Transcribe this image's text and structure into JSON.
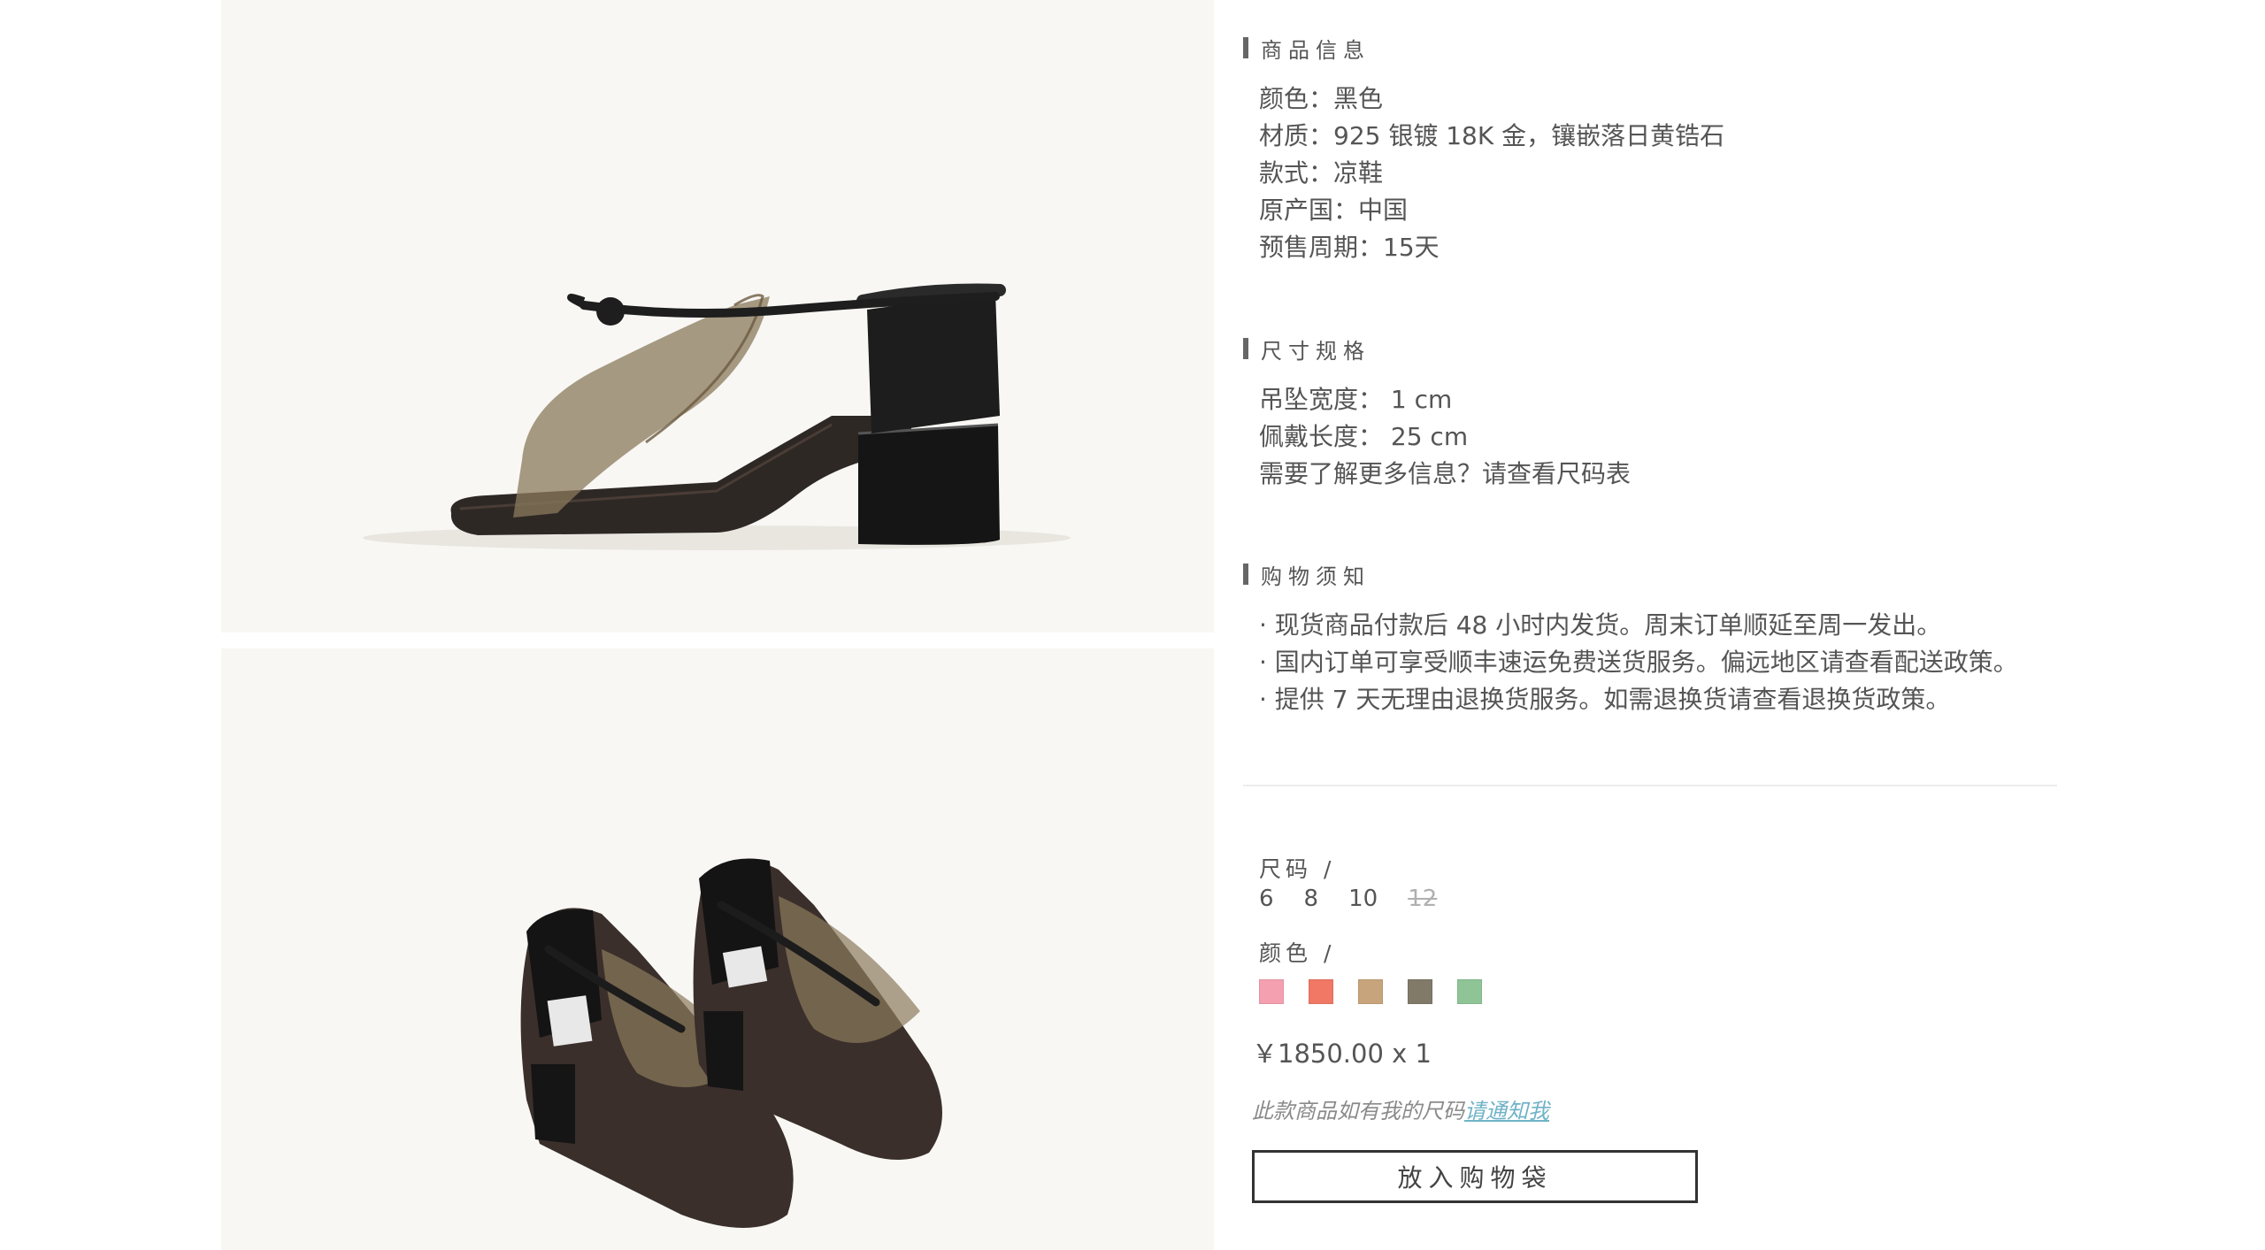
{
  "product_info": {
    "title": "商品信息",
    "lines": [
      "颜色：黑色",
      "材质：925 银镀 18K 金，镶嵌落日黄锆石",
      "款式：凉鞋",
      "原产国：中国",
      "预售周期：15天"
    ]
  },
  "size_spec": {
    "title": "尺寸规格",
    "lines": [
      "吊坠宽度： 1 cm",
      "佩戴长度： 25 cm"
    ],
    "size_chart_link": "需要了解更多信息？请查看尺码表"
  },
  "shopping_notes": {
    "title": "购物须知",
    "lines": [
      "· 现货商品付款后 48 小时内发货。周末订单顺延至周一发出。",
      "· 国内订单可享受顺丰速运免费送货服务。偏远地区请查看配送政策。",
      "· 提供 7 天无理由退换货服务。如需退换货请查看退换货政策。"
    ]
  },
  "options": {
    "size_label": "尺码 /",
    "sizes": [
      "6",
      "8",
      "10",
      "12"
    ],
    "color_label": "颜色 /",
    "colors": [
      "#f4a0b0",
      "#f07864",
      "#c8a47c",
      "#827a68",
      "#8ec496"
    ]
  },
  "price_text": "￥1850.00 x 1",
  "notify": {
    "text": "此款商品如有我的尺码",
    "link": "请通知我"
  },
  "cart_button": "放入购物袋"
}
